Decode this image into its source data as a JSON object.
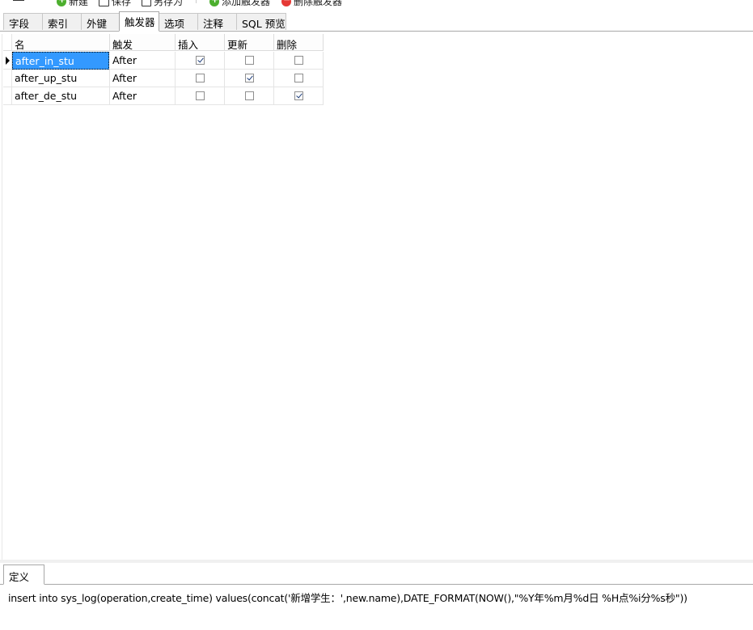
{
  "toolbar": {
    "buttons": [
      {
        "label": "新建",
        "icon": "add-icon"
      },
      {
        "label": "保存",
        "icon": "save-icon"
      },
      {
        "label": "另存为",
        "icon": "save-as-icon"
      },
      {
        "label": "添加触发器",
        "icon": "add-icon"
      },
      {
        "label": "删除触发器",
        "icon": "delete-icon"
      }
    ]
  },
  "tabs": [
    {
      "label": "字段"
    },
    {
      "label": "索引"
    },
    {
      "label": "外键"
    },
    {
      "label": "触发器",
      "active": true
    },
    {
      "label": "选项"
    },
    {
      "label": "注释"
    },
    {
      "label": "SQL 预览"
    }
  ],
  "grid": {
    "columns": [
      "名",
      "触发",
      "插入",
      "更新",
      "删除"
    ],
    "rows": [
      {
        "name": "after_in_stu",
        "timing": "After",
        "insert": true,
        "update": false,
        "delete": false
      },
      {
        "name": "after_up_stu",
        "timing": "After",
        "insert": false,
        "update": true,
        "delete": false
      },
      {
        "name": "after_de_stu",
        "timing": "After",
        "insert": false,
        "update": false,
        "delete": true
      }
    ]
  },
  "definition": {
    "tab_label": "定义",
    "sql": "insert into sys_log(operation,create_time) values(concat('新增学生：',new.name),DATE_FORMAT(NOW(),\"%Y年%m月%d日 %H点%i分%s秒\"))"
  },
  "colors": {
    "selection": "#3399ff",
    "add_icon": "#4caf2e",
    "delete_icon": "#e53935"
  }
}
